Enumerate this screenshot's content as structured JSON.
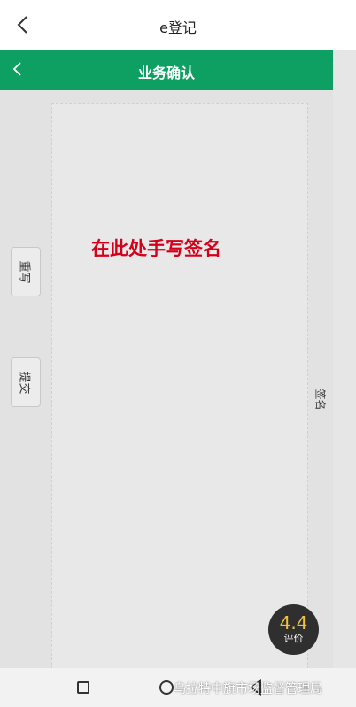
{
  "topbar": {
    "title": "e登记",
    "back_icon": "chevron-left-icon"
  },
  "greenbar": {
    "title": "业务确认",
    "back_icon": "chevron-left-icon",
    "color": "#0e9f63"
  },
  "actions": {
    "rewrite_label": "重写",
    "submit_label": "提交"
  },
  "signature_pad": {
    "hint": "在此处手写签名",
    "hint_color": "#d4001a",
    "side_label": "签名"
  },
  "rating": {
    "score": "4.4",
    "label": "评价"
  },
  "navbar": {
    "icons": [
      "square-icon",
      "circle-icon",
      "triangle-back-icon"
    ]
  },
  "watermark": "乌拉特中旗市场监督管理局"
}
